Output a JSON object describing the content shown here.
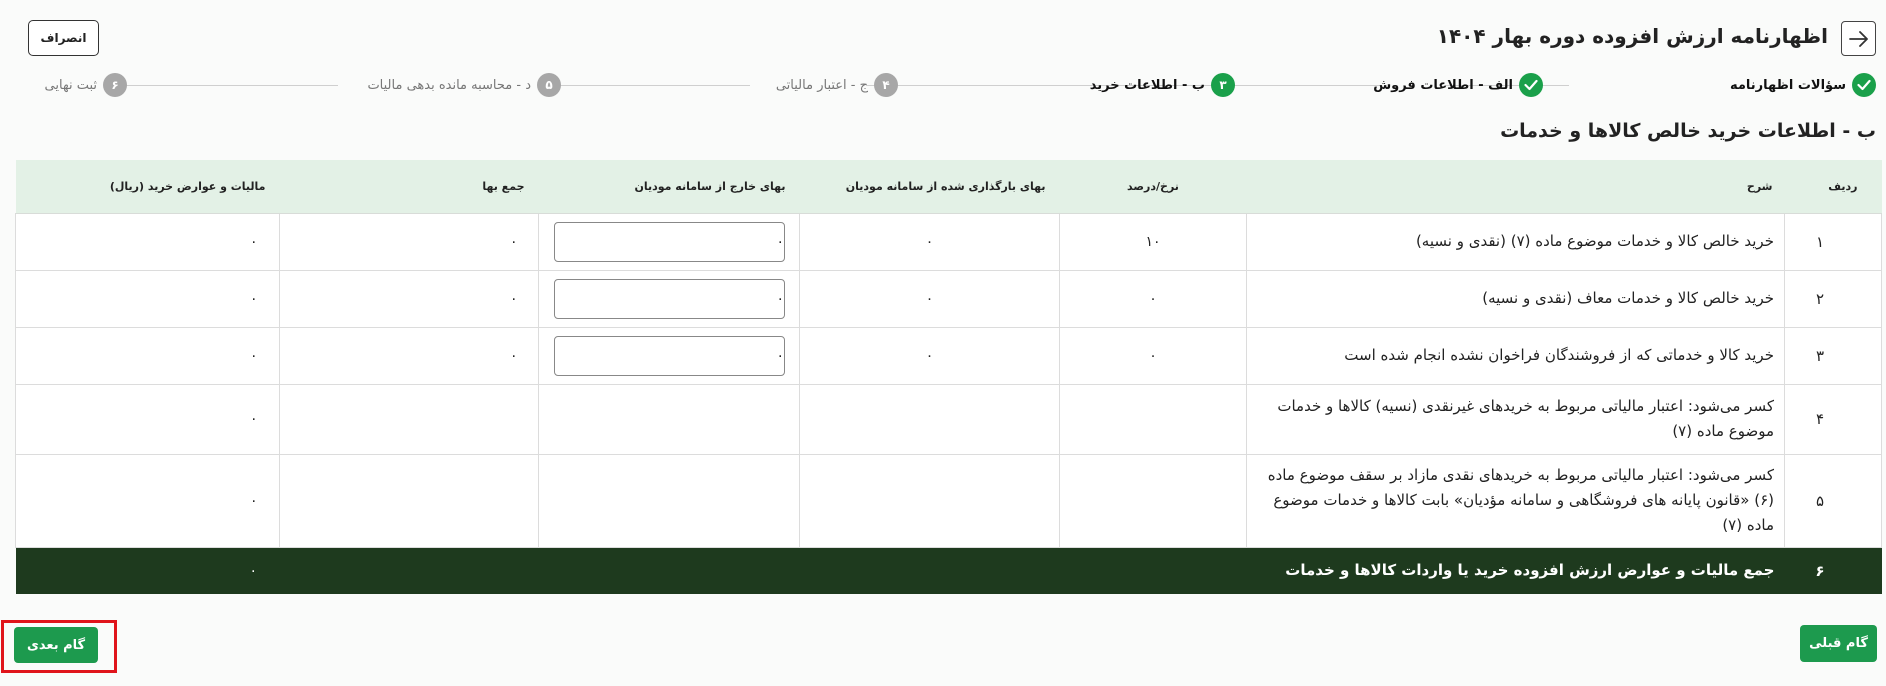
{
  "header": {
    "title": "اظهارنامه ارزش افزوده دوره بهار ۱۴۰۴",
    "cancel_label": "انصراف"
  },
  "stepper": {
    "steps": [
      {
        "label": "سؤالات اظهارنامه",
        "state": "done",
        "number": ""
      },
      {
        "label": "الف - اطلاعات فروش",
        "state": "done",
        "number": ""
      },
      {
        "label": "ب - اطلاعات خرید",
        "state": "active",
        "number": "۳"
      },
      {
        "label": "ج - اعتبار مالیاتی",
        "state": "todo",
        "number": "۴"
      },
      {
        "label": "د - محاسبه مانده بدهی مالیات",
        "state": "todo",
        "number": "۵"
      },
      {
        "label": "ثبت نهایی",
        "state": "todo",
        "number": "۶"
      }
    ]
  },
  "section": {
    "title": "ب - اطلاعات خرید خالص کالاها و خدمات"
  },
  "table": {
    "headers": {
      "row": "ردیف",
      "desc": "شرح",
      "rate": "نرخ/درصد",
      "loaded": "بهای بارگذاری شده از سامانه مودیان",
      "external": "بهای خارج از سامانه مودیان",
      "total": "جمع بها",
      "tax": "مالیات و عوارض خرید (ریال)"
    },
    "rows": [
      {
        "num": "۱",
        "desc": "خرید خالص کالا و خدمات موضوع ماده (۷) (نقدی و نسیه)",
        "rate": "۱۰",
        "loaded": "۰",
        "external": "۰",
        "total": "۰",
        "tax": "۰"
      },
      {
        "num": "۲",
        "desc": "خرید خالص کالا و خدمات معاف (نقدی و نسیه)",
        "rate": "۰",
        "loaded": "۰",
        "external": "۰",
        "total": "۰",
        "tax": "۰"
      },
      {
        "num": "۳",
        "desc": "خرید کالا و خدماتی که از فروشندگان فراخوان نشده انجام شده است",
        "rate": "۰",
        "loaded": "۰",
        "external": "۰",
        "total": "۰",
        "tax": "۰"
      },
      {
        "num": "۴",
        "desc": "کسر می‌شود: اعتبار مالیاتی مربوط به خریدهای غیرنقدی (نسیه) کالاها و خدمات موضوع ماده (۷)",
        "tax": "۰"
      },
      {
        "num": "۵",
        "desc": "کسر می‌شود: اعتبار مالیاتی مربوط به خریدهای نقدی مازاد بر سقف موضوع ماده (۶) «قانون پایانه های فروشگاهی و سامانه مؤدیان» بابت کالاها و خدمات موضوع ماده (۷)",
        "tax": "۰"
      }
    ],
    "total_row": {
      "num": "۶",
      "desc": "جمع مالیات و عوارض ارزش افزوده خرید یا واردات کالاها و خدمات",
      "tax": "۰"
    }
  },
  "footer": {
    "next_label": "گام بعدی",
    "prev_label": "گام قبلی"
  },
  "colors": {
    "accent_green": "#1d9a4e",
    "header_green": "#e3f1e6",
    "total_row_bg": "#1e3a1e",
    "highlight_red": "#e0141b"
  }
}
